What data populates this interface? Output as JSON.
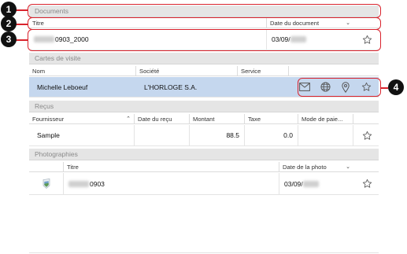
{
  "callouts": [
    "1",
    "2",
    "3",
    "4"
  ],
  "documents": {
    "section_title": "Documents",
    "col_title": "Titre",
    "col_date": "Date du document",
    "row": {
      "title": "0903_2000",
      "date": "03/09/"
    }
  },
  "cards": {
    "section_title": "Cartes de visite",
    "col_name": "Nom",
    "col_company": "Société",
    "col_service": "Service",
    "row": {
      "name": "Michelle Leboeuf",
      "company": "L'HORLOGE S.A."
    },
    "icons": [
      "mail-icon",
      "globe-icon",
      "map-pin-icon",
      "star-icon"
    ]
  },
  "receipts": {
    "section_title": "Reçus",
    "col_supplier": "Fournisseur",
    "col_date": "Date du reçu",
    "col_amount": "Montant",
    "col_tax": "Taxe",
    "col_payment": "Mode de paie...",
    "row": {
      "supplier": "Sample",
      "date": "",
      "amount": "88.5",
      "tax": "0.0",
      "payment": ""
    }
  },
  "photos": {
    "section_title": "Photographies",
    "col_title": "Titre",
    "col_date": "Date de la photo",
    "row": {
      "title": "0903",
      "date": "03/09/"
    }
  },
  "colors": {
    "callout": "#d9232d",
    "selection": "#c5d7ee",
    "header": "#e5e5e5"
  }
}
